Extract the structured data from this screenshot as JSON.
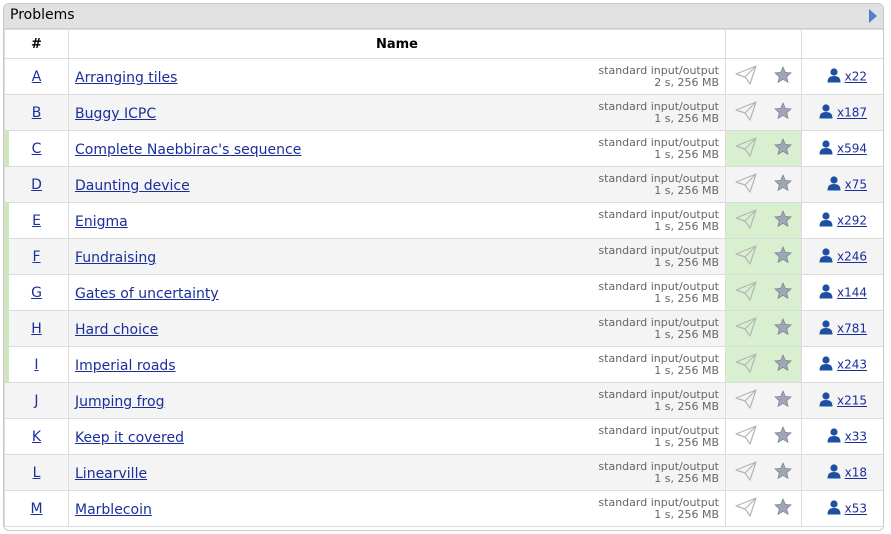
{
  "header": {
    "title": "Problems"
  },
  "columns": {
    "num": "#",
    "name": "Name"
  },
  "colors": {
    "solved": "#d8f0cf",
    "link": "#1a2e9c",
    "header_bg": "#e1e1e1"
  },
  "problems": [
    {
      "letter": "A",
      "name": "Arranging tiles",
      "io": "standard input/output",
      "limits": "2 s, 256 MB",
      "solvers": "x22",
      "solved": false
    },
    {
      "letter": "B",
      "name": "Buggy ICPC",
      "io": "standard input/output",
      "limits": "1 s, 256 MB",
      "solvers": "x187",
      "solved": false
    },
    {
      "letter": "C",
      "name": "Complete Naebbirac's sequence",
      "io": "standard input/output",
      "limits": "1 s, 256 MB",
      "solvers": "x594",
      "solved": true
    },
    {
      "letter": "D",
      "name": "Daunting device",
      "io": "standard input/output",
      "limits": "1 s, 256 MB",
      "solvers": "x75",
      "solved": false
    },
    {
      "letter": "E",
      "name": "Enigma",
      "io": "standard input/output",
      "limits": "1 s, 256 MB",
      "solvers": "x292",
      "solved": true
    },
    {
      "letter": "F",
      "name": "Fundraising",
      "io": "standard input/output",
      "limits": "1 s, 256 MB",
      "solvers": "x246",
      "solved": true
    },
    {
      "letter": "G",
      "name": "Gates of uncertainty",
      "io": "standard input/output",
      "limits": "1 s, 256 MB",
      "solvers": "x144",
      "solved": true
    },
    {
      "letter": "H",
      "name": "Hard choice",
      "io": "standard input/output",
      "limits": "1 s, 256 MB",
      "solvers": "x781",
      "solved": true
    },
    {
      "letter": "I",
      "name": "Imperial roads",
      "io": "standard input/output",
      "limits": "1 s, 256 MB",
      "solvers": "x243",
      "solved": true
    },
    {
      "letter": "J",
      "name": "Jumping frog",
      "io": "standard input/output",
      "limits": "1 s, 256 MB",
      "solvers": "x215",
      "solved": false
    },
    {
      "letter": "K",
      "name": "Keep it covered",
      "io": "standard input/output",
      "limits": "1 s, 256 MB",
      "solvers": "x33",
      "solved": false
    },
    {
      "letter": "L",
      "name": "Linearville",
      "io": "standard input/output",
      "limits": "1 s, 256 MB",
      "solvers": "x18",
      "solved": false
    },
    {
      "letter": "M",
      "name": "Marblecoin",
      "io": "standard input/output",
      "limits": "1 s, 256 MB",
      "solvers": "x53",
      "solved": false
    }
  ]
}
